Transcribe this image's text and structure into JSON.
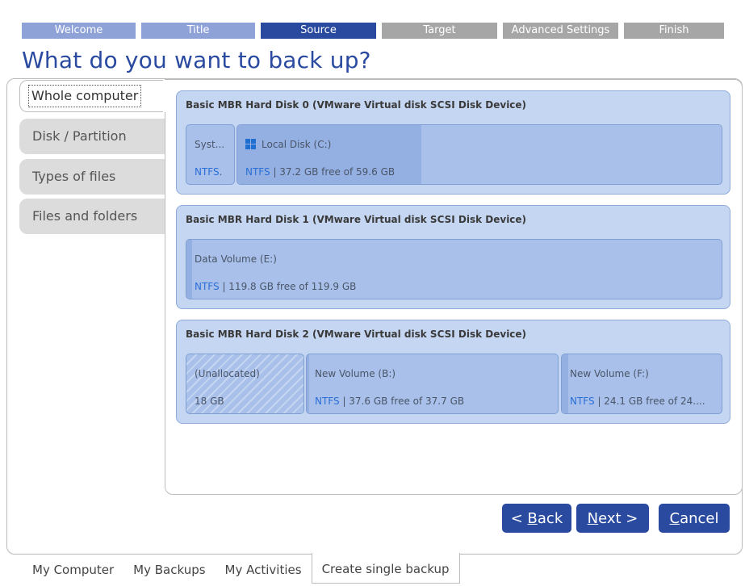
{
  "wizard_steps": [
    {
      "label": "Welcome",
      "state": "done"
    },
    {
      "label": "Title",
      "state": "done"
    },
    {
      "label": "Source",
      "state": "active"
    },
    {
      "label": "Target",
      "state": "todo"
    },
    {
      "label": "Advanced Settings",
      "state": "todo"
    },
    {
      "label": "Finish",
      "state": "todo"
    }
  ],
  "page_title": "What do you want to back up?",
  "source_tabs": [
    {
      "label": "Whole computer",
      "selected": true
    },
    {
      "label": "Disk / Partition",
      "selected": false
    },
    {
      "label": "Types of files",
      "selected": false
    },
    {
      "label": "Files and folders",
      "selected": false
    }
  ],
  "disks": [
    {
      "title": "Basic MBR Hard Disk 0 (VMware Virtual disk SCSI Disk Device)",
      "partitions": [
        {
          "name": "Syst...",
          "fs": "NTFS",
          "info": ".",
          "used_fraction": 0.0
        },
        {
          "name": "Local Disk (C:)",
          "icon": "windows-icon",
          "fs": "NTFS",
          "info": " | 37.2 GB free of 59.6 GB",
          "used_fraction": 0.38
        }
      ]
    },
    {
      "title": "Basic MBR Hard Disk 1 (VMware Virtual disk SCSI Disk Device)",
      "partitions": [
        {
          "name": "Data Volume (E:)",
          "fs": "NTFS",
          "info": " | 119.8 GB free of 119.9 GB",
          "used_fraction": 0.01
        }
      ]
    },
    {
      "title": "Basic MBR Hard Disk 2 (VMware Virtual disk SCSI Disk Device)",
      "partitions": [
        {
          "name": "(Unallocated)",
          "fs": "",
          "info": "18 GB",
          "unallocated": true
        },
        {
          "name": "New Volume (B:)",
          "fs": "NTFS",
          "info": " | 37.6 GB free of 37.7 GB",
          "used_fraction": 0.01
        },
        {
          "name": "New Volume (F:)",
          "fs": "NTFS",
          "info": " | 24.1 GB free of 24....",
          "used_fraction": 0.04
        }
      ]
    }
  ],
  "buttons": {
    "back_mnemonic": "B",
    "back_prefix": "< ",
    "back_rest": "ack",
    "next_mnemonic": "N",
    "next_rest": "ext >",
    "cancel_mnemonic": "C",
    "cancel_rest": "ancel"
  },
  "bottom_tabs": [
    {
      "label": "My Computer",
      "active": false
    },
    {
      "label": "My Backups",
      "active": false
    },
    {
      "label": "My Activities",
      "active": false
    },
    {
      "label": "Create single backup",
      "active": true
    }
  ],
  "colors": {
    "accent": "#2a4aa0",
    "done_step": "#8fa2d8",
    "todo_step": "#a6a6a6",
    "disk_bg": "#c5d6f2",
    "fs_link": "#2b6fd6"
  }
}
